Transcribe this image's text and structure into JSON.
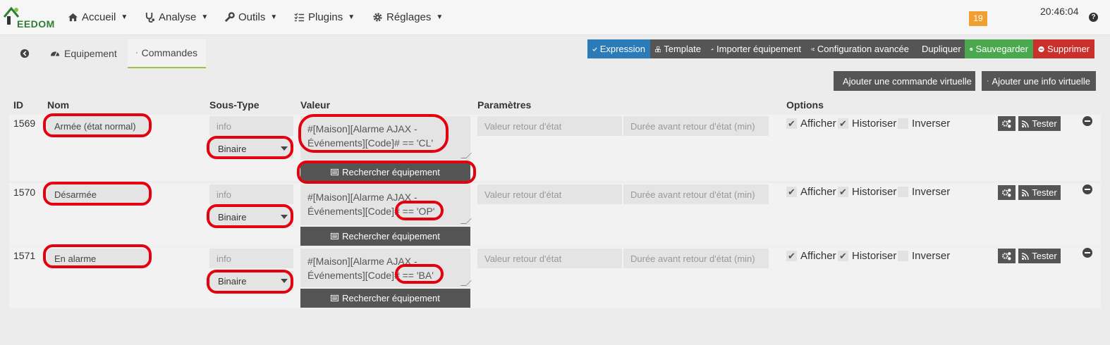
{
  "navbar": {
    "logo_text": "EEDOM",
    "menu": [
      {
        "label": "Accueil",
        "icon": "home-icon"
      },
      {
        "label": "Analyse",
        "icon": "stethoscope-icon"
      },
      {
        "label": "Outils",
        "icon": "wrench-icon"
      },
      {
        "label": "Plugins",
        "icon": "tasks-icon"
      },
      {
        "label": "Réglages",
        "icon": "gear-icon"
      }
    ],
    "notification_count": "19",
    "clock": "20:46:04",
    "help": "?"
  },
  "tabs": [
    {
      "label": "",
      "icon": "arrow-back-icon"
    },
    {
      "label": "Equipement",
      "icon": "dashboard-icon"
    },
    {
      "label": "Commandes",
      "icon": "list-icon",
      "active": true
    }
  ],
  "actions": [
    {
      "label": "Expression",
      "icon": "check-icon",
      "color": "#2b7bb9"
    },
    {
      "label": "Template",
      "icon": "cubes-icon",
      "color": "#555555"
    },
    {
      "label": "Importer équipement",
      "icon": "share-icon",
      "color": "#555555"
    },
    {
      "label": "Configuration avancée",
      "icon": "cogs-icon",
      "color": "#555555"
    },
    {
      "label": "Dupliquer",
      "icon": "copy-icon",
      "color": "#555555"
    },
    {
      "label": "Sauvegarder",
      "icon": "check-circle-icon",
      "color": "#4aa84f"
    },
    {
      "label": "Supprimer",
      "icon": "minus-circle-icon",
      "color": "#c9302c"
    }
  ],
  "add_buttons": {
    "virtual_command": "Ajouter une commande virtuelle",
    "virtual_info": "Ajouter une info virtuelle"
  },
  "columns": {
    "id": "ID",
    "name": "Nom",
    "subtype": "Sous-Type",
    "value": "Valeur",
    "params": "Paramètres",
    "options": "Options"
  },
  "rows": [
    {
      "id": "1569",
      "name": "Armée (état normal)",
      "type": "info",
      "subtype": "Binaire",
      "value_line1": "#[Maison][Alarme AJAX -",
      "value_line2": "Événements][Code]# == 'CL'",
      "search_label": "Rechercher équipement",
      "return_value_placeholder": "Valeur retour d'état",
      "return_delay_placeholder": "Durée avant retour d'état (min)",
      "opt_show": "Afficher",
      "opt_history": "Historiser",
      "opt_invert": "Inverser",
      "test_label": "Tester"
    },
    {
      "id": "1570",
      "name": "Désarmée",
      "type": "info",
      "subtype": "Binaire",
      "value_line1": "#[Maison][Alarme AJAX -",
      "value_line2": "Événements][Code]# == 'OP'",
      "search_label": "Rechercher équipement",
      "return_value_placeholder": "Valeur retour d'état",
      "return_delay_placeholder": "Durée avant retour d'état (min)",
      "opt_show": "Afficher",
      "opt_history": "Historiser",
      "opt_invert": "Inverser",
      "test_label": "Tester"
    },
    {
      "id": "1571",
      "name": "En alarme",
      "type": "info",
      "subtype": "Binaire",
      "value_line1": "#[Maison][Alarme AJAX -",
      "value_line2": "Événements][Code]# == 'BA'",
      "search_label": "Rechercher équipement",
      "return_value_placeholder": "Valeur retour d'état",
      "return_delay_placeholder": "Durée avant retour d'état (min)",
      "opt_show": "Afficher",
      "opt_history": "Historiser",
      "opt_invert": "Inverser",
      "test_label": "Tester"
    }
  ],
  "highlight_color": "#e4000f"
}
